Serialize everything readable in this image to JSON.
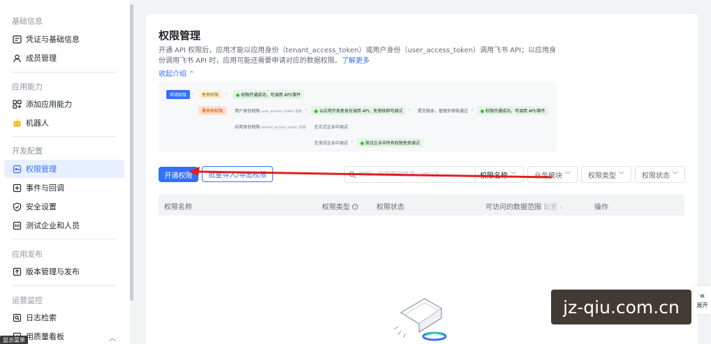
{
  "sidebar": {
    "groups": [
      {
        "label": "基础信息",
        "items": [
          {
            "label": "凭证与基础信息",
            "icon": "credential-icon"
          },
          {
            "label": "成员管理",
            "icon": "user-icon"
          }
        ]
      },
      {
        "label": "应用能力",
        "items": [
          {
            "label": "添加应用能力",
            "icon": "grid-add-icon"
          },
          {
            "label": "机器人",
            "icon": "robot-icon"
          }
        ]
      },
      {
        "label": "开发配置",
        "items": [
          {
            "label": "权限管理",
            "icon": "key-icon",
            "active": true
          },
          {
            "label": "事件与回调",
            "icon": "event-icon"
          },
          {
            "label": "安全设置",
            "icon": "shield-icon"
          },
          {
            "label": "测试企业和人员",
            "icon": "test-icon"
          }
        ]
      },
      {
        "label": "应用发布",
        "items": [
          {
            "label": "版本管理与发布",
            "icon": "upload-icon"
          }
        ]
      },
      {
        "label": "运营监控",
        "items": [
          {
            "label": "日志检索",
            "icon": "log-icon"
          },
          {
            "label": "用质量看板",
            "icon": "dashboard-icon"
          }
        ]
      }
    ],
    "bottom_tooltip": "显示菜单",
    "accent_color": "#3370ff"
  },
  "main": {
    "title": "权限管理",
    "description": "开通 API 权限后，应用才能以应用身份（tenant_access_token）或用户身份（user_access_token）调用飞书 API；以应用身份调用飞书 API 时，应用可能还需要申请对应的数据权限。",
    "learn_more": "了解更多",
    "collapse_label": "收起介绍"
  },
  "flow": {
    "start": "申请权限",
    "row1_a": "免审权限",
    "row1_b": "权限开通成功，可调用 API/事件",
    "row2_a": "需审核权限",
    "row2_b": "用户身份权限",
    "row2_b_sub": "user_access_token 调用",
    "row2_c": "以应用开发者身份调用 API，免审核即可调试",
    "row2_d": "提交版本，管理员审核通过",
    "row2_e": "权限开通成功，可调用 API/事件",
    "row3_a": "应用身份权限",
    "row3_a_sub": "tenant_access_token 调用",
    "row3_b": "在正式企业中调试",
    "row4_a": "在测试企业中调试",
    "row4_b": "测试企业中所有权限免审调试"
  },
  "toolbar": {
    "primary_button": "开通权限",
    "secondary_button": "批量导入/导出权限",
    "search_placeholder": "例如：获取群组信息、im:ch...",
    "search_scope": "权限名称",
    "filters": [
      "业务模块",
      "权限类型",
      "权限状态"
    ]
  },
  "table": {
    "columns": [
      {
        "label": "权限名称"
      },
      {
        "label": "权限类型",
        "icon": "help-icon"
      },
      {
        "label": "权限状态"
      },
      {
        "label": "可访问的数据范围",
        "suffix": "配置"
      },
      {
        "label": "操作"
      }
    ]
  },
  "expand_panel": {
    "label": "展开"
  },
  "watermark": "jz-qiu.com.cn",
  "annotation_color": "#e02020"
}
